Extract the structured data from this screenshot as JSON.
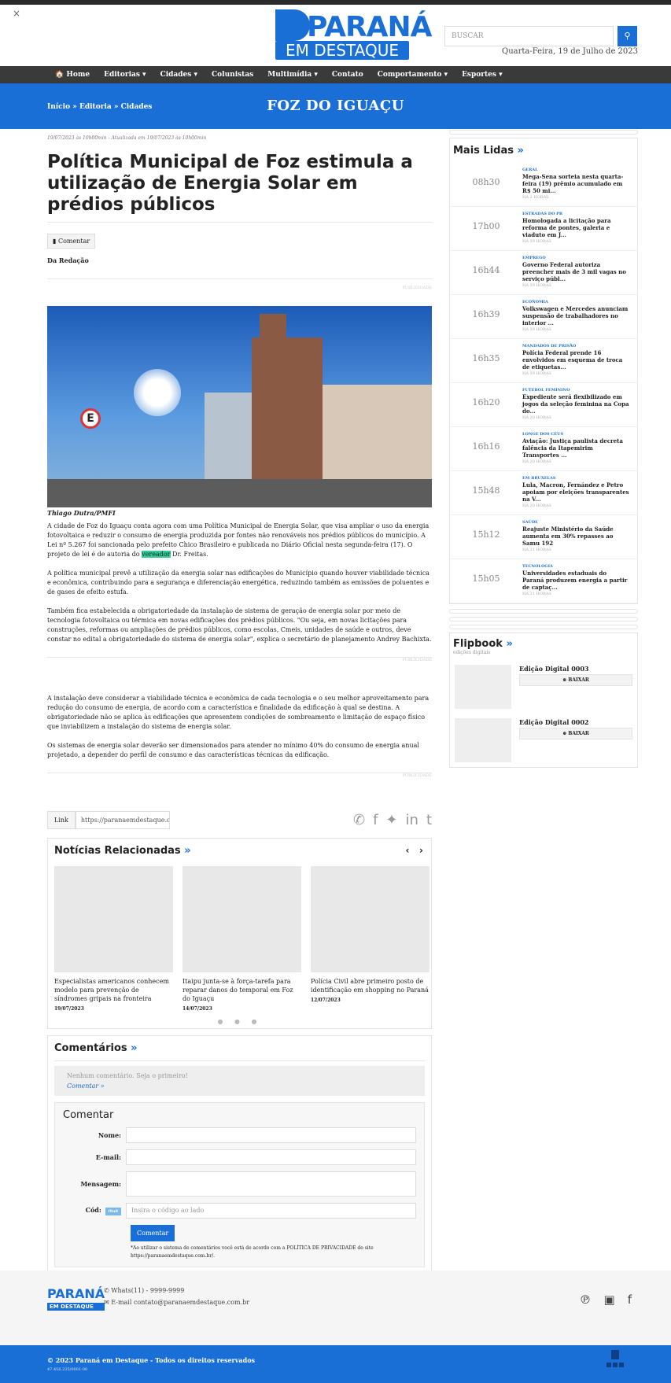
{
  "header": {
    "close_label": "×",
    "logo_main": "PARANÁ",
    "logo_sub": "EM DESTAQUE",
    "search_placeholder": "BUSCAR",
    "search_icon": "search-icon",
    "date": "Quarta-Feira, 19 de Julho de 2023"
  },
  "nav": {
    "items": [
      "Home",
      "Editorias ▾",
      "Cidades ▾",
      "Colunistas",
      "Multimídia ▾",
      "Contato",
      "Comportamento ▾",
      "Esportes ▾"
    ]
  },
  "band": {
    "breadcrumb": "Início  »  Editoria  »  Cidades",
    "title": "FOZ DO IGUAÇU"
  },
  "article": {
    "meta": "19/07/2023 às 10h00min - Atualizada em 19/07/2023 às 10h00min",
    "title": "Política Municipal de Foz estimula a utilização de Energia Solar em prédios públicos",
    "comment_button": "Comentar",
    "author": "Da Redação",
    "pub_label": "PUBLICIDADE",
    "photo_sign": "E",
    "caption": "Thiago Dutra/PMFI",
    "p1a": "A cidade de Foz do Iguaçu conta agora com uma Política Municipal de Energia Solar, que visa ampliar o uso da energia fotovoltaica e reduzir o consumo de energia produzida por fontes não renováveis nos prédios públicos do município. A Lei nº 5.267 foi sancionada pelo prefeito Chico Brasileiro e publicada no Diário Oficial nesta segunda-feira (17). O projeto de lei é de autoria do ",
    "p1_mark": "vereador",
    "p1b": " Dr. Freitas.",
    "p2": "A política municipal prevê a utilização da energia solar nas edificações do Município quando houver viabilidade técnica e econômica, contribuindo para a segurança e diferenciação energética, reduzindo também as emissões de poluentes e de gases de efeito estufa.",
    "p3": "Também fica estabelecida a obrigatoriedade da instalação de sistema de geração de energia solar por meio de tecnologia fotovoltaica ou térmica em novas edificações dos prédios públicos. \"Ou seja, em novas licitações para construções, reformas ou ampliações de prédios públicos, como escolas, Cmeis, unidades de saúde e outros, deve constar no edital a obrigatoriedade do sistema de energia solar\", explica o secretário de planejamento Andrey Bachixta.",
    "p4": "A instalação deve considerar a viabilidade técnica e econômica de cada tecnologia e o seu melhor aproveitamento para redução do consumo de energia, de acordo com a característica e finalidade da edificação à qual se destina. A obrigatoriedade não se aplica às edificações que apresentem condições de sombreamento e limitação de espaço físico que inviabilizem a instalação do sistema de energia solar.",
    "p5": "Os sistemas de energia solar deverão ser dimensionados para atender no mínimo 40% do consumo de energia anual projetado, a depender do perfil de consumo e das características técnicas da edificação."
  },
  "share": {
    "link_label": "Link",
    "link_value": "https://paranaemdestaque.com",
    "icons": [
      "whatsapp-icon",
      "facebook-icon",
      "twitter-icon",
      "linkedin-icon",
      "tumblr-icon"
    ]
  },
  "related": {
    "title": "Notícias Relacionadas",
    "raquo": "»",
    "prev": "‹",
    "next": "›",
    "dots": "● ● ●",
    "items": [
      {
        "title": "Especialistas americanos conhecem modelo para prevenção de síndromes gripais na fronteira",
        "date": "19/07/2023"
      },
      {
        "title": "Itaipu junta-se à força-tarefa para reparar danos do temporal em Foz do Iguaçu",
        "date": "14/07/2023"
      },
      {
        "title": "Polícia Civil abre primeiro posto de identificação em shopping no Paraná",
        "date": "12/07/2023"
      }
    ]
  },
  "comments": {
    "title": "Comentários",
    "raquo": "»",
    "empty": "Nenhum comentário. Seja o primeiro!",
    "link": "Comentar »"
  },
  "form": {
    "title": "Comentar",
    "name_label": "Nome:",
    "email_label": "E-mail:",
    "message_label": "Mensagem:",
    "code_label": "Cód:",
    "captcha": "f9a8",
    "code_placeholder": "Insira o código ao lado",
    "submit": "Comentar",
    "terms": "*Ao utilizar o sistema de comentários você está de acordo com a POLÍTICA DE PRIVACIDADE do site https://paranaemdestaque.com.br/."
  },
  "sidebar": {
    "ml_title": "Mais Lidas",
    "raquo": "»",
    "items": [
      {
        "time": "08h30",
        "cat": "GERAL",
        "title": "Mega-Sena sorteia nesta quarta-feira (19) prêmio acumulado em R$ 50 mi...",
        "ago": "HÁ 2 HORAS"
      },
      {
        "time": "17h00",
        "cat": "ESTRADAS DO PR",
        "title": "Homologada a licitação para reforma de pontes, galeria e viaduto em J...",
        "ago": "HÁ 19 HORAS"
      },
      {
        "time": "16h44",
        "cat": "EMPREGO",
        "title": "Governo Federal autoriza preencher mais de 3 mil vagas no serviço públ...",
        "ago": "HÁ 19 HORAS"
      },
      {
        "time": "16h39",
        "cat": "ECONOMIA",
        "title": "Volkswagen e Mercedes anunciam suspensão de trabalhadores no interior ...",
        "ago": "HÁ 19 HORAS"
      },
      {
        "time": "16h35",
        "cat": "MANDADOS DE PRISÃO",
        "title": "Polícia Federal prende 16 envolvidos em esquema de troca de etiquetas...",
        "ago": "HÁ 19 HORAS"
      },
      {
        "time": "16h20",
        "cat": "FUTEBOL FEMININO",
        "title": "Expediente será flexibilizado em jogos da seleção feminina na Copa do...",
        "ago": "HÁ 20 HORAS"
      },
      {
        "time": "16h16",
        "cat": "LONGE DOS CÉUS",
        "title": "Aviação: Justiça paulista decreta falência da Itapemirim Transportes ...",
        "ago": "HÁ 20 HORAS"
      },
      {
        "time": "15h48",
        "cat": "EM BRUXELAS",
        "title": "Lula, Macron, Fernández e Petro apoiam por eleições transparentes na V...",
        "ago": "HÁ 20 HORAS"
      },
      {
        "time": "15h12",
        "cat": "SAÚDE",
        "title": "Reajuste Ministério da Saúde aumenta em 30% repasses ao Samu 192",
        "ago": "HÁ 21 HORAS"
      },
      {
        "time": "15h05",
        "cat": "TECNOLOGIA",
        "title": "Universidades estaduais do Paraná produzem energia a partir de captaç...",
        "ago": "HÁ 21 HORAS"
      }
    ],
    "fb_title": "Flipbook",
    "fb_sub": "edições digitais",
    "fb_items": [
      {
        "name": "Edição Digital 0003",
        "dl": "⊕ BAIXAR"
      },
      {
        "name": "Edição Digital 0002",
        "dl": "⊕ BAIXAR"
      }
    ]
  },
  "footer": {
    "logo": "PARANÁ",
    "logo_sub": "EM DESTAQUE",
    "whats": "✆ Whats(11) - 9999-9999",
    "email": "✉ E-mail contato@paranaemdestaque.com.br",
    "social": [
      "rss-icon",
      "instagram-icon",
      "facebook-icon"
    ],
    "copyright": "© 2023 Paraná em Destaque - Todos os direitos reservados",
    "cnpj": "47.456.235/0001-00"
  },
  "colors": {
    "brand": "#1a6fd6",
    "nav": "#3a3a3a"
  }
}
